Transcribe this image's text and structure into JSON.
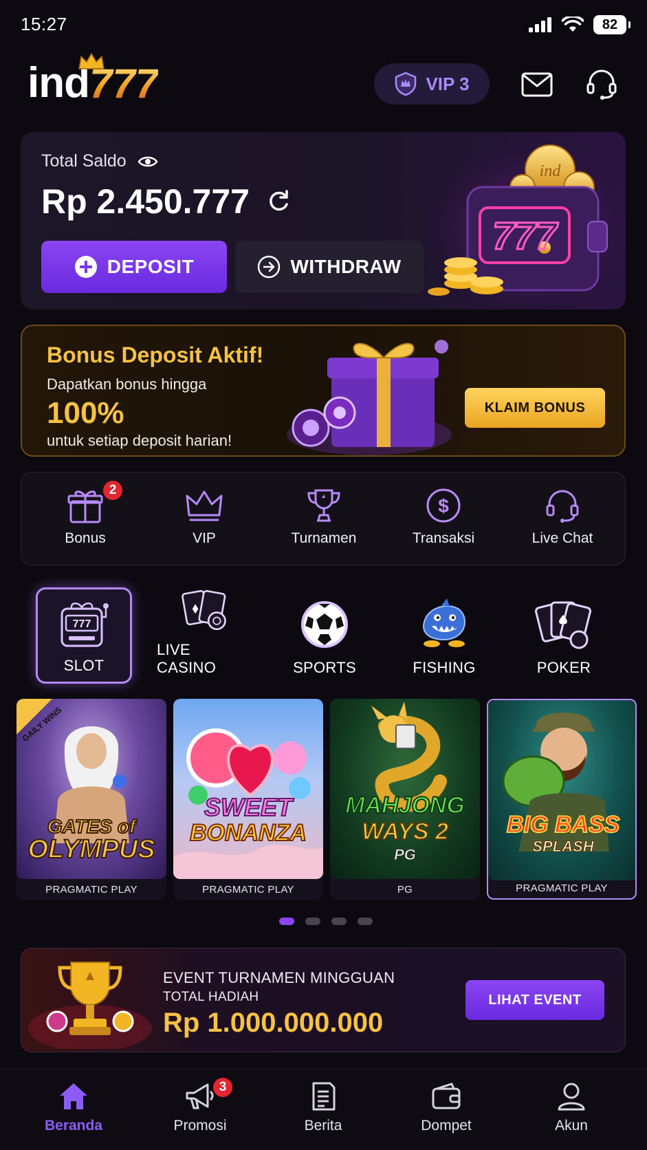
{
  "status_bar": {
    "time": "15:27",
    "battery": "82"
  },
  "header": {
    "logo_text": "ind",
    "logo_number": "777",
    "vip_label": "VIP 3"
  },
  "balance": {
    "label": "Total Saldo",
    "value": "Rp 2.450.777",
    "deposit_label": "DEPOSIT",
    "withdraw_label": "WITHDRAW",
    "wallet_coin_text": "ind",
    "wallet_sign_text": "777"
  },
  "bonus_banner": {
    "title": "Bonus Deposit Aktif!",
    "subtitle": "Dapatkan bonus hingga",
    "percentage": "100%",
    "subtitle2": "untuk setiap deposit harian!",
    "button_label": "KLAIM BONUS"
  },
  "quick_menu": [
    {
      "label": "Bonus",
      "icon": "gift-icon",
      "badge": "2"
    },
    {
      "label": "VIP",
      "icon": "crown-icon"
    },
    {
      "label": "Turnamen",
      "icon": "trophy-icon"
    },
    {
      "label": "Transaksi",
      "icon": "dollar-icon"
    },
    {
      "label": "Live Chat",
      "icon": "headset-icon"
    }
  ],
  "categories": [
    {
      "label": "SLOT",
      "icon": "slot-machine-icon",
      "active": true
    },
    {
      "label": "LIVE CASINO",
      "icon": "cards-chips-icon"
    },
    {
      "label": "SPORTS",
      "icon": "soccer-ball-icon"
    },
    {
      "label": "FISHING",
      "icon": "shark-icon"
    },
    {
      "label": "POKER",
      "icon": "poker-cards-icon"
    }
  ],
  "games": [
    {
      "title_line1": "GATES of",
      "title_line2": "OLYMPUS",
      "provider": "PRAGMATIC PLAY",
      "ribbon": "GAILY WINS"
    },
    {
      "title_line1": "SWEET",
      "title_line2": "BONANZA",
      "provider": "PRAGMATIC PLAY"
    },
    {
      "title_line1": "MAHJONG",
      "title_line2": "WAYS 2",
      "title_line3": "PG",
      "provider": "PG"
    },
    {
      "title_line1": "BIG BASS",
      "title_line2": "SPLASH",
      "provider": "PRAGMATIC PLAY"
    }
  ],
  "carousel": {
    "page_count": 4,
    "active_page": 1
  },
  "event_banner": {
    "line1": "EVENT TURNAMEN MINGGUAN",
    "line2": "TOTAL HADIAH",
    "amount": "Rp 1.000.000.000",
    "button_label": "LIHAT EVENT"
  },
  "bottom_nav": [
    {
      "label": "Beranda",
      "icon": "home-icon",
      "active": true
    },
    {
      "label": "Promosi",
      "icon": "megaphone-icon",
      "badge": "3"
    },
    {
      "label": "Berita",
      "icon": "news-icon"
    },
    {
      "label": "Dompet",
      "icon": "wallet-icon"
    },
    {
      "label": "Akun",
      "icon": "user-icon"
    }
  ],
  "colors": {
    "accent": "#8b45f2",
    "gold": "#f5c243",
    "background": "#0c0a10",
    "badge": "#e3262f"
  }
}
